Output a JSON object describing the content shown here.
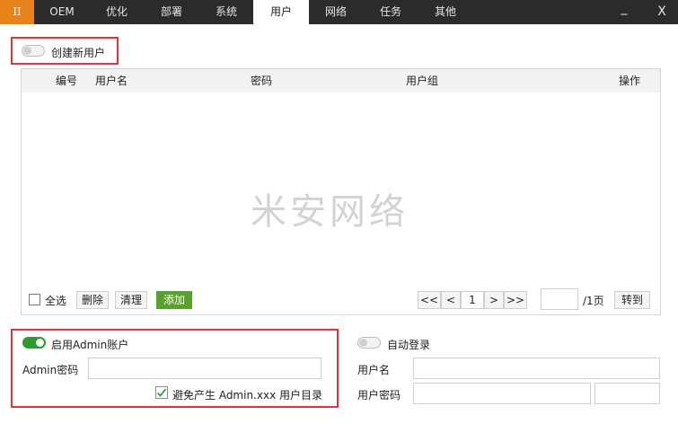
{
  "tabs": [
    {
      "label": "II"
    },
    {
      "label": "OEM"
    },
    {
      "label": "优化"
    },
    {
      "label": "部署"
    },
    {
      "label": "系统"
    },
    {
      "label": "用户"
    },
    {
      "label": "网络"
    },
    {
      "label": "任务"
    },
    {
      "label": "其他"
    }
  ],
  "window": {
    "minimize": "_",
    "close": "X"
  },
  "create_user": {
    "label": "创建新用户",
    "enabled": false
  },
  "table": {
    "columns": [
      "编号",
      "用户名",
      "密码",
      "用户组",
      "操作"
    ],
    "rows": [],
    "watermark": "米安网络"
  },
  "footer": {
    "select_all": "全选",
    "delete": "删除",
    "clear": "清理",
    "add": "添加",
    "first": "<<",
    "prev": "<",
    "page": "1",
    "next": ">",
    "last": ">>",
    "page_input": "",
    "total": "/1页",
    "goto": "转到"
  },
  "admin": {
    "toggle_label": "启用Admin账户",
    "enabled": true,
    "password_label": "Admin密码",
    "password_value": "",
    "avoid_label": "避免产生 Admin.xxx 用户目录",
    "avoid_checked": true
  },
  "autologin": {
    "toggle_label": "自动登录",
    "enabled": false,
    "username_label": "用户名",
    "username_value": "",
    "password_label": "用户密码",
    "password_value": ""
  },
  "colors": {
    "tabbar": "#2b2b2b",
    "pause_tab": "#e8821a",
    "highlight_box": "#d9363e",
    "toggle_on": "#2e9b2e",
    "add_button": "#5aa02c"
  }
}
